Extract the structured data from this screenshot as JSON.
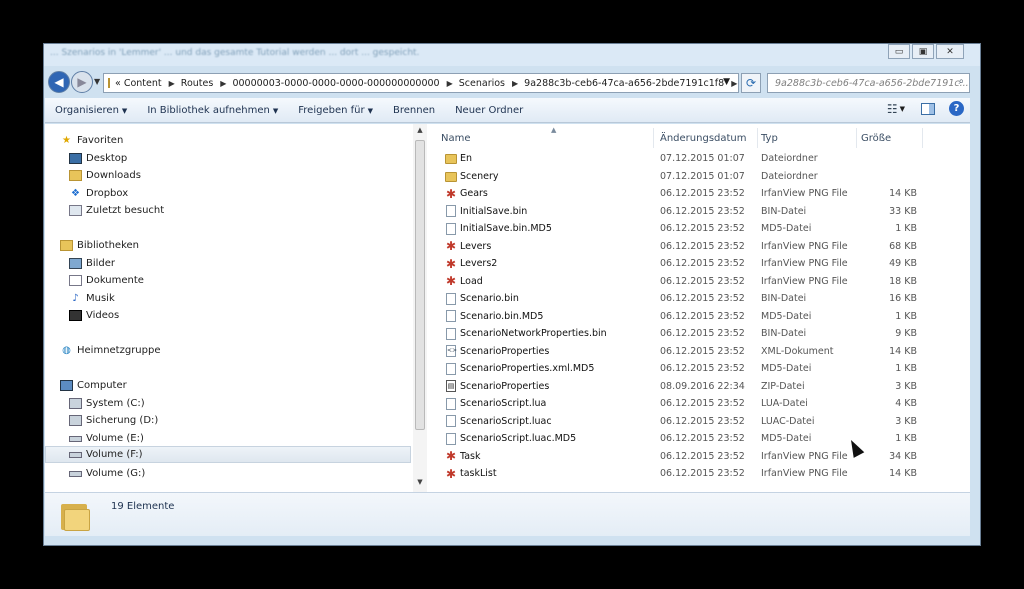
{
  "window": {
    "blurred_title": "... Szenarios in 'Lemmer' ... und das gesamte Tutorial werden ... dort ... gespeicht.",
    "buttons": {
      "minimize": "▭",
      "maximize": "▣",
      "close": "✕"
    }
  },
  "address": {
    "overflow": "«",
    "crumbs": [
      "Content",
      "Routes",
      "00000003-0000-0000-0000-000000000000",
      "Scenarios",
      "9a288c3b-ceb6-47ca-a656-2bde7191c1f8"
    ],
    "search_placeholder": "9a288c3b-ceb6-47ca-a656-2bde7191c..."
  },
  "toolbar": {
    "organize": "Organisieren",
    "library": "In Bibliothek aufnehmen",
    "share": "Freigeben für",
    "burn": "Brennen",
    "new_folder": "Neuer Ordner"
  },
  "nav": {
    "favorites": "Favoriten",
    "desktop": "Desktop",
    "downloads": "Downloads",
    "dropbox": "Dropbox",
    "recent": "Zuletzt besucht",
    "libraries": "Bibliotheken",
    "pictures": "Bilder",
    "documents": "Dokumente",
    "music": "Musik",
    "videos": "Videos",
    "homegroup": "Heimnetzgruppe",
    "computer": "Computer",
    "drive_c": "System (C:)",
    "drive_d": "Sicherung (D:)",
    "drive_e": "Volume (E:)",
    "drive_f": "Volume (F:)",
    "drive_g": "Volume (G:)"
  },
  "columns": {
    "name": "Name",
    "date": "Änderungsdatum",
    "type": "Typ",
    "size": "Größe"
  },
  "files": [
    {
      "name": "En",
      "date": "07.12.2015 01:07",
      "type": "Dateiordner",
      "size": "",
      "icon": "folder"
    },
    {
      "name": "Scenery",
      "date": "07.12.2015 01:07",
      "type": "Dateiordner",
      "size": "",
      "icon": "folder"
    },
    {
      "name": "Gears",
      "date": "06.12.2015 23:52",
      "type": "IrfanView PNG File",
      "size": "14 KB",
      "icon": "png"
    },
    {
      "name": "InitialSave.bin",
      "date": "06.12.2015 23:52",
      "type": "BIN-Datei",
      "size": "33 KB",
      "icon": "doc"
    },
    {
      "name": "InitialSave.bin.MD5",
      "date": "06.12.2015 23:52",
      "type": "MD5-Datei",
      "size": "1 KB",
      "icon": "doc"
    },
    {
      "name": "Levers",
      "date": "06.12.2015 23:52",
      "type": "IrfanView PNG File",
      "size": "68 KB",
      "icon": "png"
    },
    {
      "name": "Levers2",
      "date": "06.12.2015 23:52",
      "type": "IrfanView PNG File",
      "size": "49 KB",
      "icon": "png"
    },
    {
      "name": "Load",
      "date": "06.12.2015 23:52",
      "type": "IrfanView PNG File",
      "size": "18 KB",
      "icon": "png"
    },
    {
      "name": "Scenario.bin",
      "date": "06.12.2015 23:52",
      "type": "BIN-Datei",
      "size": "16 KB",
      "icon": "doc"
    },
    {
      "name": "Scenario.bin.MD5",
      "date": "06.12.2015 23:52",
      "type": "MD5-Datei",
      "size": "1 KB",
      "icon": "doc"
    },
    {
      "name": "ScenarioNetworkProperties.bin",
      "date": "06.12.2015 23:52",
      "type": "BIN-Datei",
      "size": "9 KB",
      "icon": "doc"
    },
    {
      "name": "ScenarioProperties",
      "date": "06.12.2015 23:52",
      "type": "XML-Dokument",
      "size": "14 KB",
      "icon": "xml"
    },
    {
      "name": "ScenarioProperties.xml.MD5",
      "date": "06.12.2015 23:52",
      "type": "MD5-Datei",
      "size": "1 KB",
      "icon": "doc"
    },
    {
      "name": "ScenarioProperties",
      "date": "08.09.2016 22:34",
      "type": "ZIP-Datei",
      "size": "3 KB",
      "icon": "zip"
    },
    {
      "name": "ScenarioScript.lua",
      "date": "06.12.2015 23:52",
      "type": "LUA-Datei",
      "size": "4 KB",
      "icon": "doc"
    },
    {
      "name": "ScenarioScript.luac",
      "date": "06.12.2015 23:52",
      "type": "LUAC-Datei",
      "size": "3 KB",
      "icon": "doc"
    },
    {
      "name": "ScenarioScript.luac.MD5",
      "date": "06.12.2015 23:52",
      "type": "MD5-Datei",
      "size": "1 KB",
      "icon": "doc"
    },
    {
      "name": "Task",
      "date": "06.12.2015 23:52",
      "type": "IrfanView PNG File",
      "size": "34 KB",
      "icon": "png"
    },
    {
      "name": "taskList",
      "date": "06.12.2015 23:52",
      "type": "IrfanView PNG File",
      "size": "14 KB",
      "icon": "png"
    }
  ],
  "status": {
    "count": "19 Elemente"
  }
}
